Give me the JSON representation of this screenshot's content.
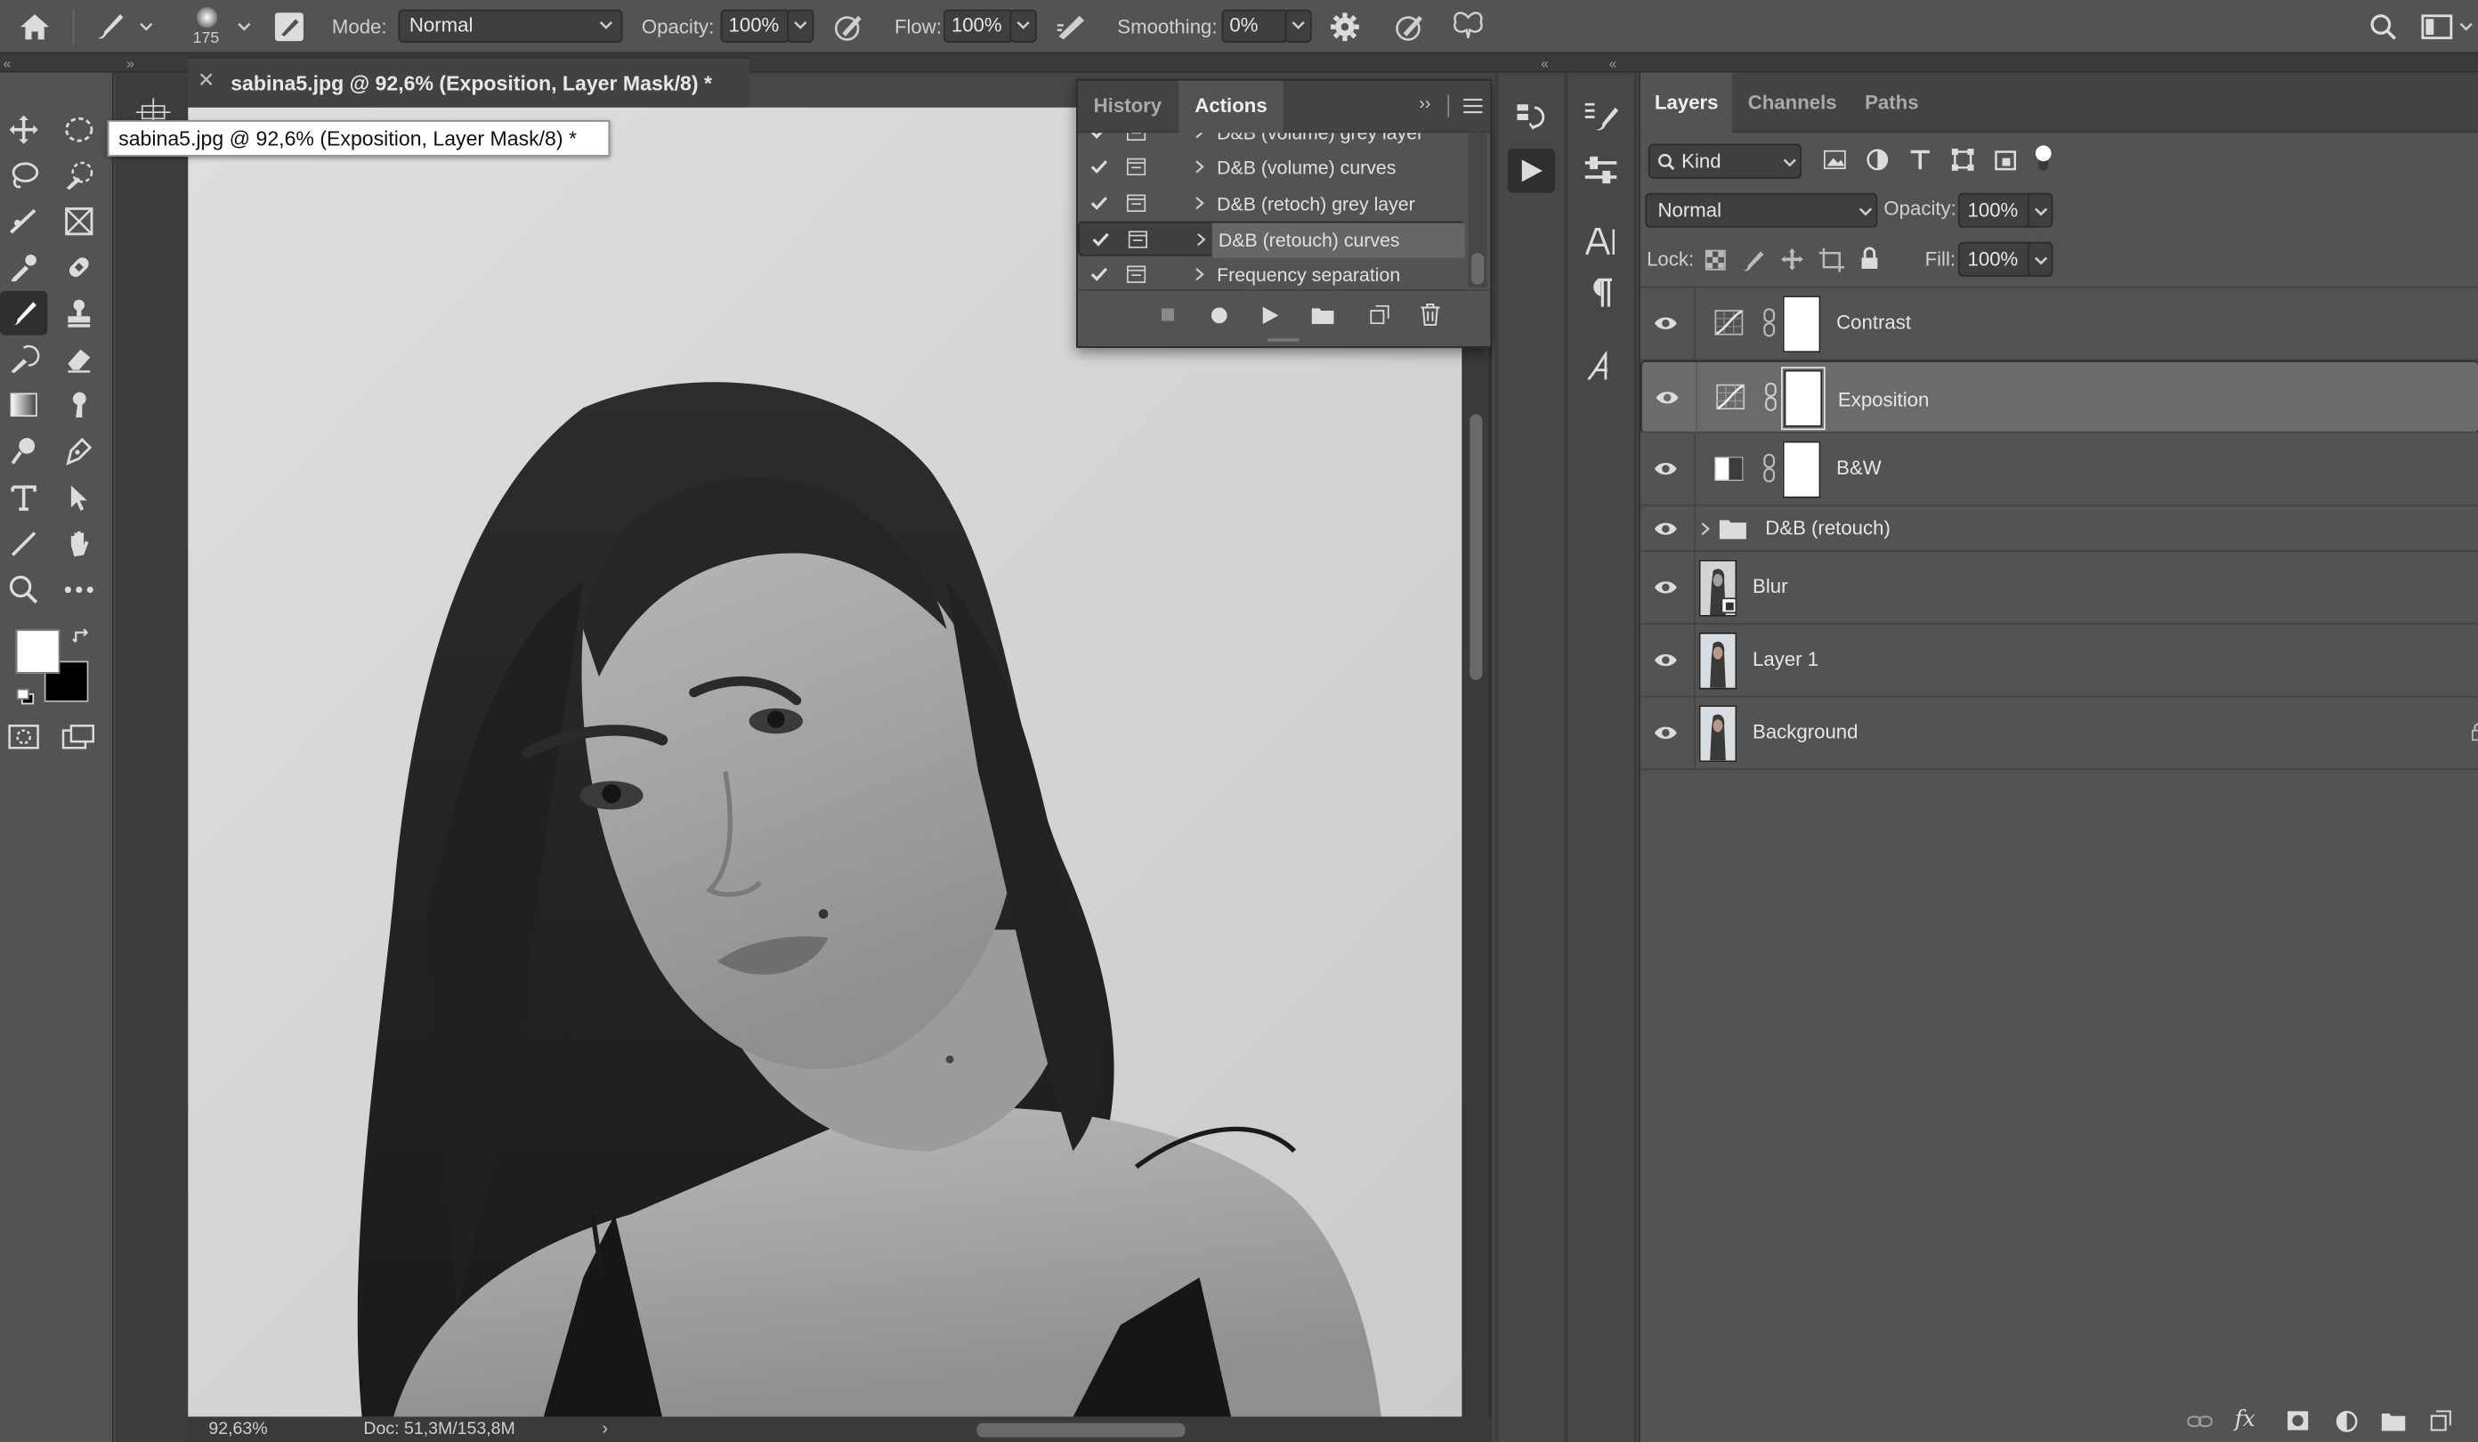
{
  "options_bar": {
    "brush_size": "175",
    "mode_label": "Mode:",
    "mode_value": "Normal",
    "opacity_label": "Opacity:",
    "opacity_value": "100%",
    "flow_label": "Flow:",
    "flow_value": "100%",
    "smoothing_label": "Smoothing:",
    "smoothing_value": "0%"
  },
  "document": {
    "tab_title": "sabina5.jpg @ 92,6% (Exposition, Layer Mask/8) *",
    "tooltip": "sabina5.jpg @ 92,6% (Exposition, Layer Mask/8) *",
    "zoom": "92,63%",
    "doc_info": "Doc: 51,3M/153,8M"
  },
  "actions_panel": {
    "tabs": [
      {
        "label": "History",
        "active": false
      },
      {
        "label": "Actions",
        "active": true
      }
    ],
    "items": [
      {
        "label": "D&B (volume) grey layer",
        "checked": true,
        "selected": false
      },
      {
        "label": "D&B (volume) curves",
        "checked": true,
        "selected": false
      },
      {
        "label": "D&B (retoch) grey layer",
        "checked": true,
        "selected": false
      },
      {
        "label": "D&B (retouch) curves",
        "checked": true,
        "selected": true
      },
      {
        "label": "Frequency separation",
        "checked": true,
        "selected": false
      }
    ]
  },
  "layers_panel": {
    "tabs": [
      {
        "label": "Layers",
        "active": true
      },
      {
        "label": "Channels",
        "active": false
      },
      {
        "label": "Paths",
        "active": false
      }
    ],
    "filter_kind": "Kind",
    "blend_mode": "Normal",
    "opacity_label": "Opacity:",
    "opacity_value": "100%",
    "lock_label": "Lock:",
    "fill_label": "Fill:",
    "fill_value": "100%",
    "layers": [
      {
        "name": "Contrast",
        "kind": "curves-adjustment",
        "selected": false
      },
      {
        "name": "Exposition",
        "kind": "curves-adjustment",
        "selected": true
      },
      {
        "name": "B&W",
        "kind": "bw-adjustment",
        "selected": false
      },
      {
        "name": "D&B (retouch)",
        "kind": "group",
        "selected": false
      },
      {
        "name": "Blur",
        "kind": "smart-object",
        "selected": false
      },
      {
        "name": "Layer 1",
        "kind": "pixel",
        "selected": false
      },
      {
        "name": "Background",
        "kind": "pixel",
        "selected": false
      }
    ]
  },
  "colors": {
    "panel_bg": "#535353",
    "dark_bg": "#474747",
    "selected_row": "#6b6b6b",
    "foreground_swatch": "#ffffff",
    "background_swatch": "#000000"
  }
}
